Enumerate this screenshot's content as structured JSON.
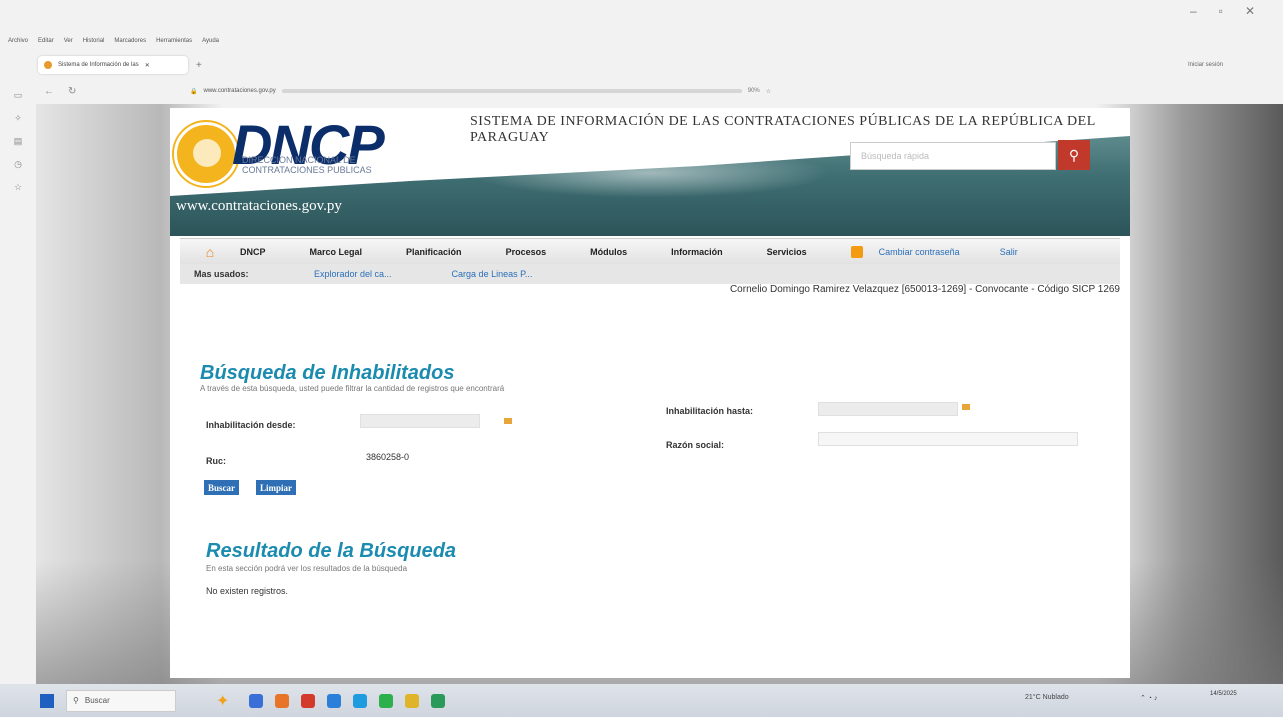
{
  "browser": {
    "menu": [
      "Archivo",
      "Editar",
      "Ver",
      "Historial",
      "Marcadores",
      "Herramientas",
      "Ayuda"
    ],
    "tab_title": "Sistema de Información de las",
    "login_label": "Iniciar sesión",
    "url": "www.contrataciones.gov.py",
    "zoom": "90%"
  },
  "header": {
    "logo": "DNCP",
    "logo_sub1": "DIRECCION NACIONAL DE",
    "logo_sub2": "CONTRATACIONES PUBLICAS",
    "system_title": "SISTEMA DE INFORMACIÓN DE LAS CONTRATACIONES PÚBLICAS DE LA REPÚBLICA DEL PARAGUAY",
    "site_url": "www.contrataciones.gov.py",
    "search_placeholder": "Búsqueda rápida"
  },
  "nav": {
    "items": [
      "DNCP",
      "Marco Legal",
      "Planificación",
      "Procesos",
      "Módulos",
      "Información",
      "Servicios"
    ],
    "change_password": "Cambiar contraseña",
    "logout": "Salir"
  },
  "mas_usados": {
    "label": "Mas usados:",
    "links": [
      "Explorador del ca...",
      "Carga de Lineas P..."
    ]
  },
  "user_info": "Cornelio Domingo Ramirez Velazquez [650013-1269] - Convocante - Código SICP 1269",
  "search": {
    "title": "Búsqueda de Inhabilitados",
    "description": "A través de esta búsqueda, usted puede filtrar la cantidad de registros que encontrará",
    "desde_label": "Inhabilitación desde:",
    "hasta_label": "Inhabilitación hasta:",
    "ruc_label": "Ruc:",
    "ruc_value": "3860258-0",
    "razon_label": "Razón social:",
    "buscar": "Buscar",
    "limpiar": "Limpiar"
  },
  "result": {
    "title": "Resultado de la Búsqueda",
    "description": "En esta sección podrá ver los resultados de la búsqueda",
    "empty": "No existen registros."
  },
  "taskbar": {
    "search": "Buscar",
    "weather": "21°C Nublado",
    "time": "14/5/2025"
  }
}
